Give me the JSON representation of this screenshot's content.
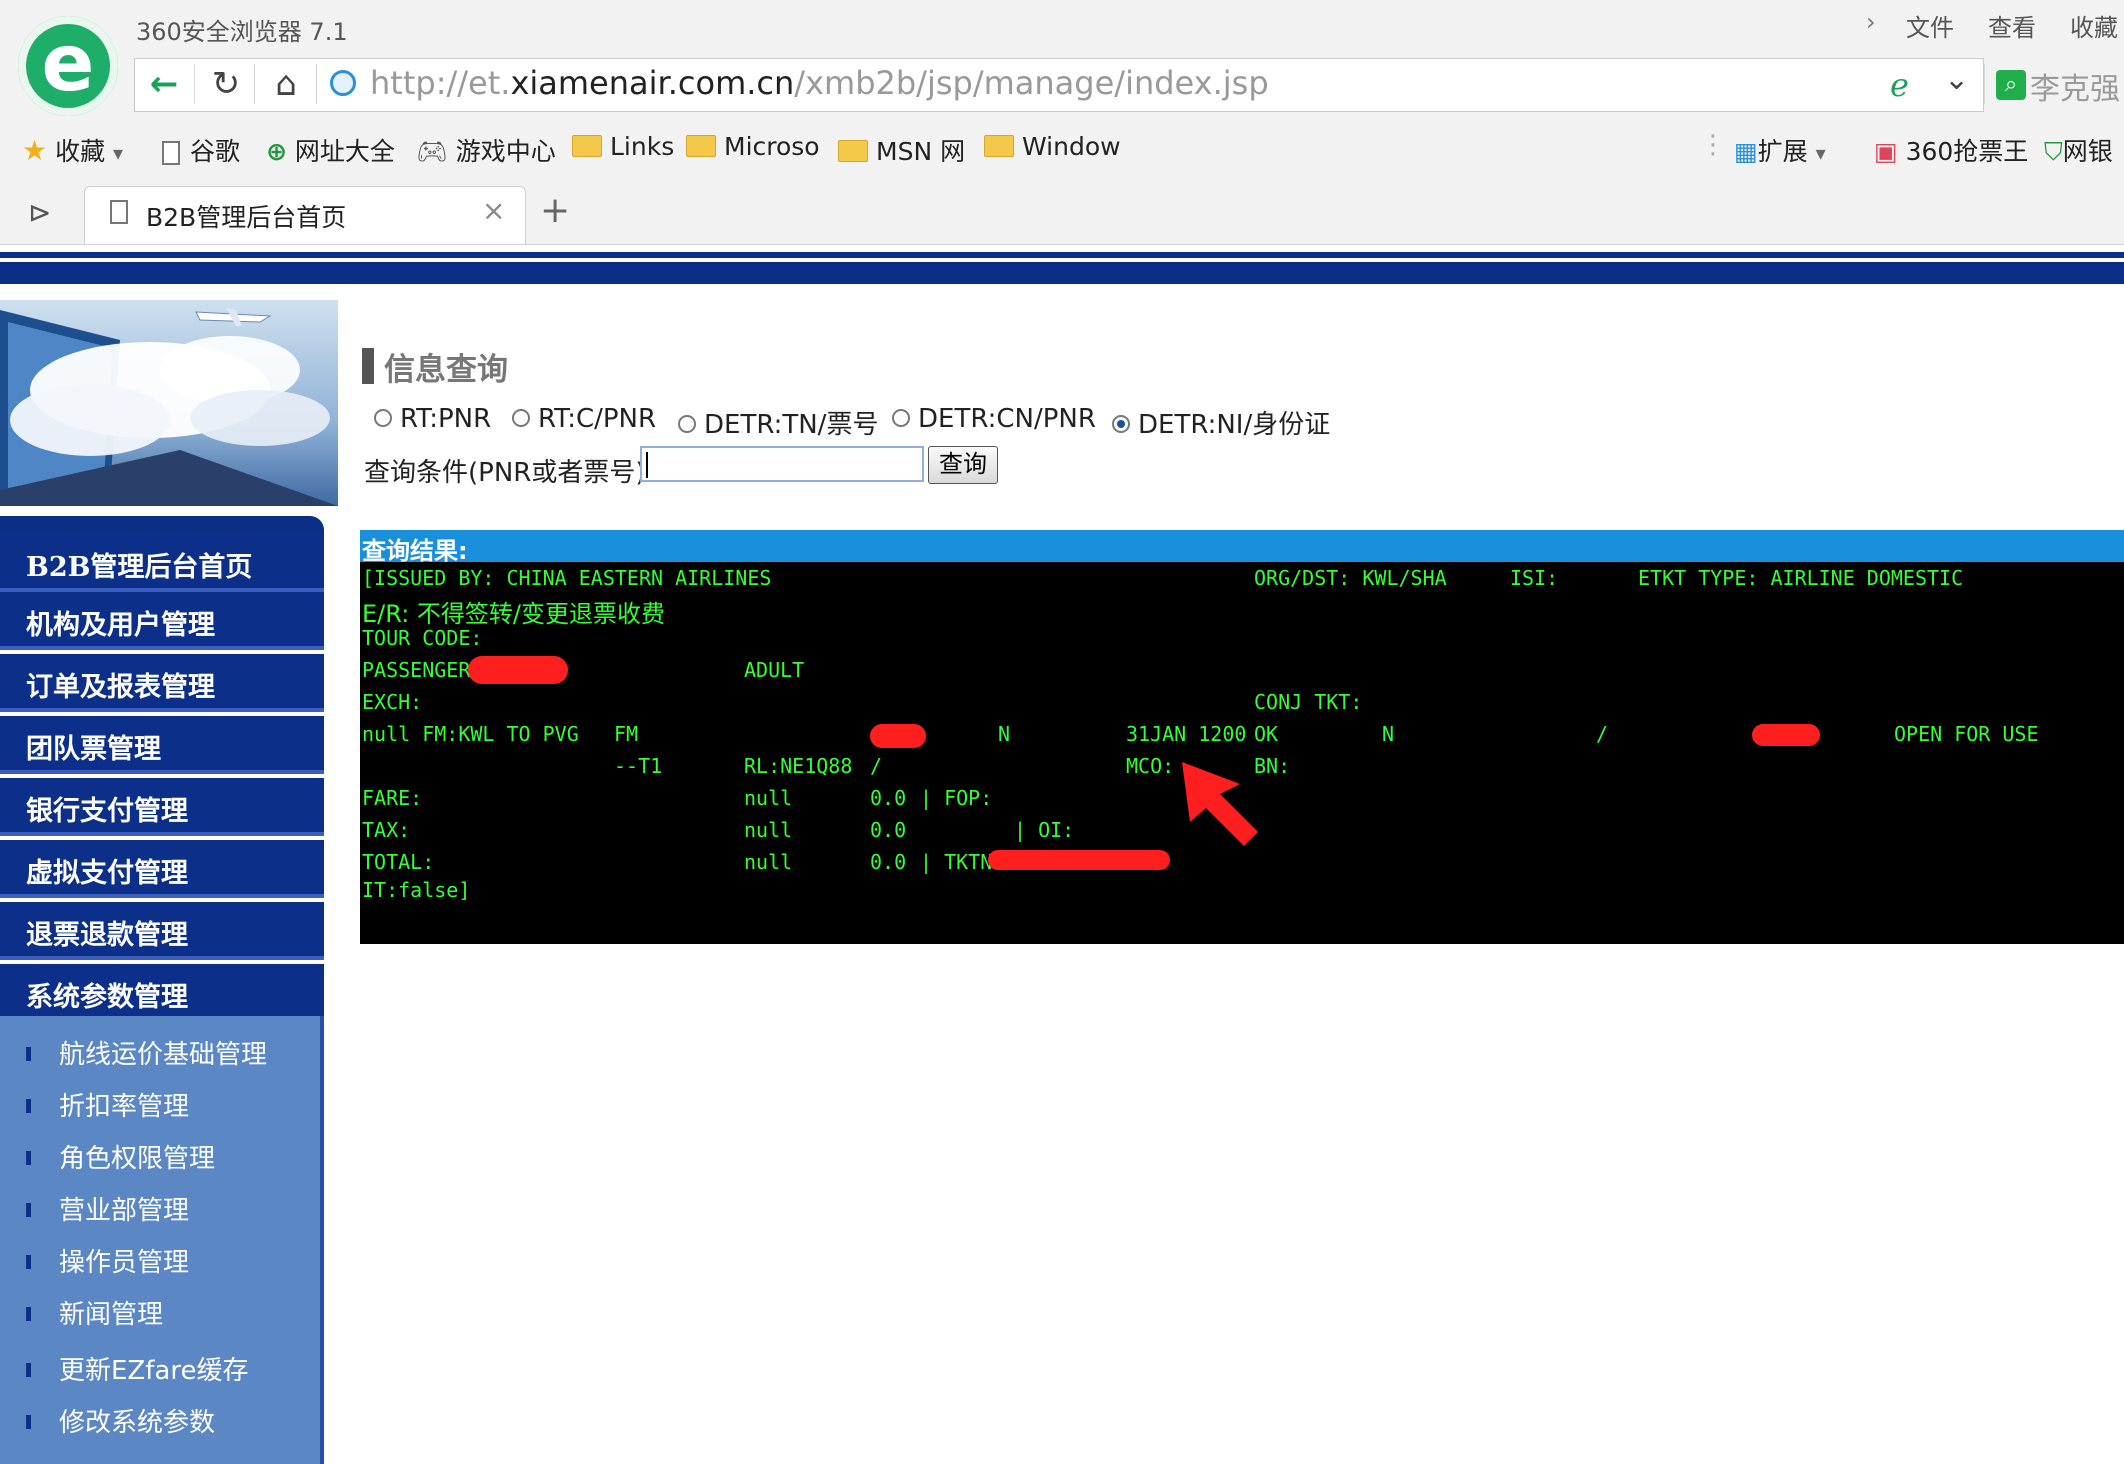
{
  "browser": {
    "app_title": "360安全浏览器 7.1",
    "menu": [
      "文件",
      "查看",
      "收藏"
    ],
    "url_prefix": "http://et.",
    "url_domain": "xiamenair.com.cn",
    "url_path": "/xmb2b/jsp/manage/index.jsp",
    "search_user": "李克强",
    "bookmarks": {
      "favorites": "收藏",
      "google": "谷歌",
      "sites": "网址大全",
      "games": "游戏中心",
      "links": "Links",
      "microsoft": "Microso",
      "msn": "MSN 网",
      "windows": "Window",
      "extensions": "扩展",
      "ticket": "360抢票王",
      "bank": "网银"
    },
    "tab_title": "B2B管理后台首页",
    "new_tab": "+",
    "tab_close": "×"
  },
  "sidebar": {
    "nav": [
      "B2B管理后台首页",
      "机构及用户管理",
      "订单及报表管理",
      "团队票管理",
      "银行支付管理",
      "虚拟支付管理",
      "退票退款管理",
      "系统参数管理"
    ],
    "sub": [
      "航线运价基础管理",
      "折扣率管理",
      "角色权限管理",
      "营业部管理",
      "操作员管理",
      "新闻管理",
      "更新EZfare缓存",
      "修改系统参数"
    ]
  },
  "query": {
    "section_title": "信息查询",
    "options": [
      "RT:PNR",
      "RT:C/PNR",
      "DETR:TN/票号",
      "DETR:CN/PNR",
      "DETR:NI/身份证"
    ],
    "selected_index": 4,
    "condition_label": "查询条件(PNR或者票号):",
    "input_value": "",
    "button_label": "查询"
  },
  "result": {
    "title": "查询结果:",
    "lines": {
      "issued": "[ISSUED BY: CHINA EASTERN AIRLINES",
      "org_dst": "ORG/DST: KWL/SHA",
      "isi": "ISI:",
      "etkt": "ETKT TYPE: AIRLINE DOMESTIC",
      "er": "E/R: 不得签转/变更退票收费",
      "tour": "TOUR CODE:",
      "passenger": "PASSENGER:",
      "adult": "ADULT",
      "exch": "EXCH:",
      "conj": "CONJ TKT:",
      "seg_from": "null FM:KWL TO PVG",
      "seg_fm": "FM",
      "seg_n1": "N",
      "seg_date": "31JAN 1200",
      "seg_ok": "OK",
      "seg_n2": "N",
      "seg_slash": "/",
      "seg_status": "OPEN FOR USE",
      "t1": "--T1",
      "rl": "RL:NE1Q88",
      "rl_slash": "/",
      "mco": "MCO:",
      "bn": "BN:",
      "fare": "FARE:",
      "fare_null": "null",
      "fare_val": "0.0",
      "fop": "| FOP:",
      "tax": "TAX:",
      "tax_null": "null",
      "tax_val": "0.0",
      "oi": "| OI:",
      "total": "TOTAL:",
      "total_null": "null",
      "total_val": "0.0",
      "tktn": "| TKTN",
      "it": "IT:false]"
    }
  },
  "colors": {
    "nav_bg": "#0c2f8a",
    "subnav_bg": "#5b87c4",
    "terminal_text": "#33ff33",
    "result_header": "#1a8fdc",
    "annotation_red": "#ff1f1f"
  }
}
